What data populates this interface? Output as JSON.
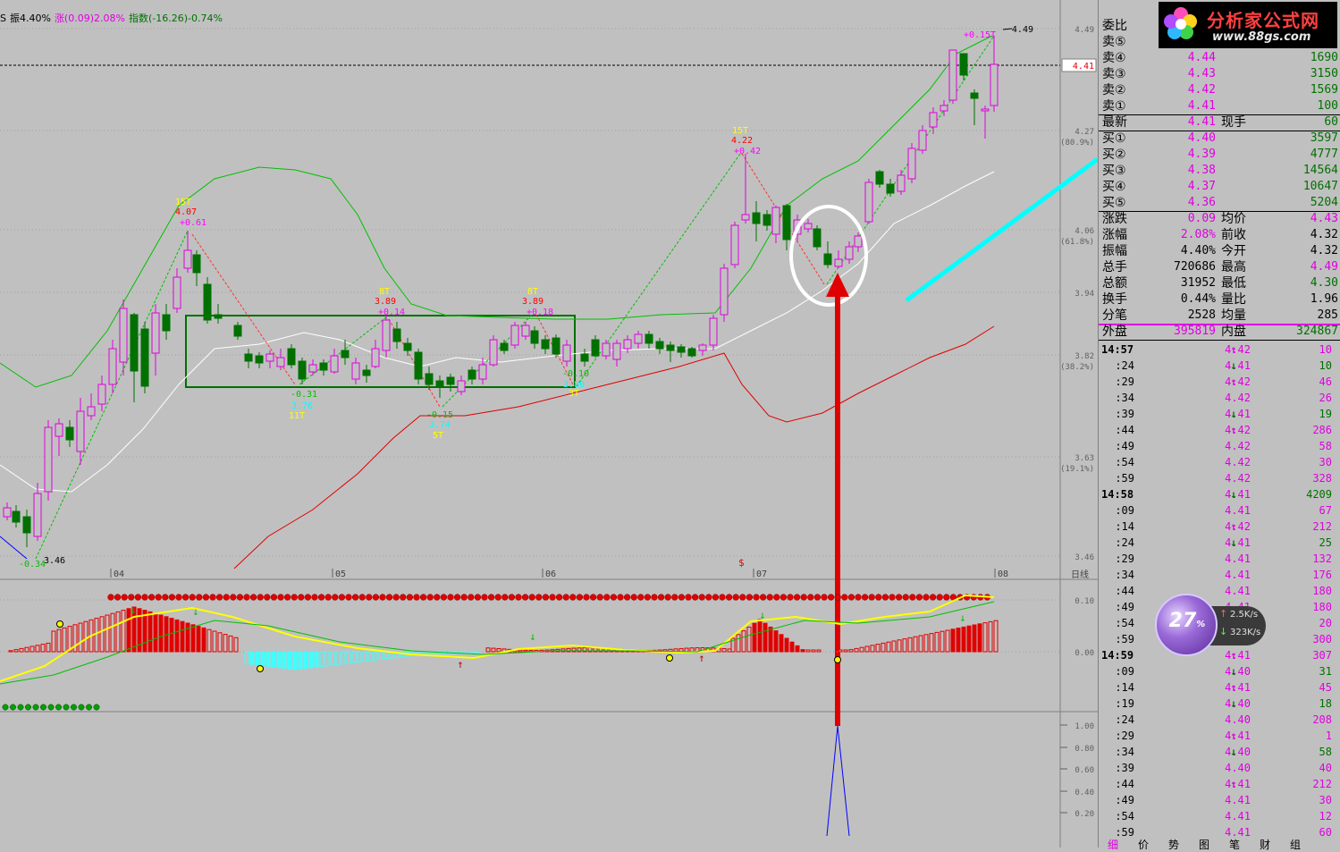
{
  "info_bar": {
    "prefix": "S",
    "amplitude": "振4.40%",
    "change": "涨(0.09)2.08%",
    "index": "指数(-16.26)-0.74%"
  },
  "price_axis": [
    {
      "label": "4.49"
    },
    {
      "label": "4.27",
      "pct": "(80.9%)"
    },
    {
      "label": "4.06",
      "pct": "(61.8%)"
    },
    {
      "label": "3.94"
    },
    {
      "label": "3.82",
      "pct": "(38.2%)"
    },
    {
      "label": "3.63",
      "pct": "(19.1%)"
    },
    {
      "label": "3.46"
    }
  ],
  "current_price_tag": "4.41",
  "high_price_tag": "4.49",
  "months": [
    "04",
    "05",
    "06",
    "07",
    "08"
  ],
  "period_label": "日线",
  "chart_annotations": [
    {
      "text": "15T",
      "color": "#ffff00"
    },
    {
      "text": "4.07",
      "color": "#ff0000"
    },
    {
      "text": "+0.61",
      "color": "#ff00ff"
    },
    {
      "text": "8T",
      "color": "#ffff00"
    },
    {
      "text": "3.89",
      "color": "#ff0000"
    },
    {
      "text": "+0.14",
      "color": "#ff00ff"
    },
    {
      "text": "8T",
      "color": "#ffff00"
    },
    {
      "text": "3.89",
      "color": "#ff0000"
    },
    {
      "text": "+0.18",
      "color": "#ff00ff"
    },
    {
      "text": "15T",
      "color": "#ffff00"
    },
    {
      "text": "4.22",
      "color": "#ff0000"
    },
    {
      "text": "+0.42",
      "color": "#ff00ff"
    },
    {
      "text": "-0.31",
      "color": "#00c000"
    },
    {
      "text": "3.76",
      "color": "#00ffff"
    },
    {
      "text": "11T",
      "color": "#ffff00"
    },
    {
      "text": "-0.15",
      "color": "#00c000"
    },
    {
      "text": "3.74",
      "color": "#00ffff"
    },
    {
      "text": "5T",
      "color": "#ffff00"
    },
    {
      "text": "-0.10",
      "color": "#00c000"
    },
    {
      "text": "3.80",
      "color": "#00ffff"
    },
    {
      "text": "3T",
      "color": "#ffff00"
    },
    {
      "text": "-0.34",
      "color": "#00c000"
    },
    {
      "text": "3.46",
      "color": "#000000"
    },
    {
      "text": "+0.15T",
      "color": "#ff00ff"
    }
  ],
  "macd_axis": [
    "0.10",
    "0.00"
  ],
  "bottom_axis": [
    "1.00",
    "0.80",
    "0.60",
    "0.40",
    "0.20"
  ],
  "quote": {
    "weibi_label": "委比",
    "asks": [
      {
        "label": "卖⑤",
        "price": "",
        "vol": ""
      },
      {
        "label": "卖④",
        "price": "4.44",
        "vol": "1690"
      },
      {
        "label": "卖③",
        "price": "4.43",
        "vol": "3150"
      },
      {
        "label": "卖②",
        "price": "4.42",
        "vol": "1569"
      },
      {
        "label": "卖①",
        "price": "4.41",
        "vol": "100"
      }
    ],
    "latest": {
      "label": "最新",
      "price": "4.41",
      "label2": "现手",
      "vol": "60"
    },
    "bids": [
      {
        "label": "买①",
        "price": "4.40",
        "vol": "3597"
      },
      {
        "label": "买②",
        "price": "4.39",
        "vol": "4777"
      },
      {
        "label": "买③",
        "price": "4.38",
        "vol": "14564"
      },
      {
        "label": "买④",
        "price": "4.37",
        "vol": "10647"
      },
      {
        "label": "买⑤",
        "price": "4.36",
        "vol": "5204"
      }
    ],
    "stats": [
      {
        "l1": "涨跌",
        "v1": "0.09",
        "c1": "pink",
        "l2": "均价",
        "v2": "4.43",
        "c2": "pink"
      },
      {
        "l1": "涨幅",
        "v1": "2.08%",
        "c1": "pink",
        "l2": "前收",
        "v2": "4.32",
        "c2": "black"
      },
      {
        "l1": "振幅",
        "v1": "4.40%",
        "c1": "black",
        "l2": "今开",
        "v2": "4.32",
        "c2": "black"
      },
      {
        "l1": "总手",
        "v1": "720686",
        "c1": "black",
        "l2": "最高",
        "v2": "4.49",
        "c2": "pink"
      },
      {
        "l1": "总额",
        "v1": "31952",
        "c1": "black",
        "l2": "最低",
        "v2": "4.30",
        "c2": "green"
      },
      {
        "l1": "换手",
        "v1": "0.44%",
        "c1": "black",
        "l2": "量比",
        "v2": "1.96",
        "c2": "black"
      },
      {
        "l1": "分笔",
        "v1": "2528",
        "c1": "black",
        "l2": "均量",
        "v2": "285",
        "c2": "black"
      }
    ],
    "outer_label": "外盘",
    "outer_vol": "395819",
    "inner_label": "内盘",
    "inner_vol": "324867"
  },
  "ticks": [
    {
      "time": "14:57",
      "bold": true,
      "price": "4.42",
      "dir": "up",
      "vol": "10"
    },
    {
      "time": ":24",
      "price": "4.41",
      "dir": "dn",
      "vol": "10"
    },
    {
      "time": ":29",
      "price": "4.42",
      "dir": "up",
      "vol": "46"
    },
    {
      "time": ":34",
      "price": "4.42",
      "dir": "",
      "vol": "26"
    },
    {
      "time": ":39",
      "price": "4.41",
      "dir": "dn",
      "vol": "19"
    },
    {
      "time": ":44",
      "price": "4.42",
      "dir": "up",
      "vol": "286"
    },
    {
      "time": ":49",
      "price": "4.42",
      "dir": "",
      "vol": "58"
    },
    {
      "time": ":54",
      "price": "4.42",
      "dir": "",
      "vol": "30"
    },
    {
      "time": ":59",
      "price": "4.42",
      "dir": "",
      "vol": "328"
    },
    {
      "time": "14:58",
      "bold": true,
      "price": "4.41",
      "dir": "dn",
      "vol": "4209"
    },
    {
      "time": ":09",
      "price": "4.41",
      "dir": "",
      "vol": "67"
    },
    {
      "time": ":14",
      "price": "4.42",
      "dir": "up",
      "vol": "212"
    },
    {
      "time": ":24",
      "price": "4.41",
      "dir": "dn",
      "vol": "25"
    },
    {
      "time": ":29",
      "price": "4.41",
      "dir": "",
      "vol": "132"
    },
    {
      "time": ":34",
      "price": "4.41",
      "dir": "",
      "vol": "176"
    },
    {
      "time": ":44",
      "price": "4.41",
      "dir": "",
      "vol": "180"
    },
    {
      "time": ":49",
      "price": "4.41",
      "dir": "",
      "vol": "180"
    },
    {
      "time": ":54",
      "price": "4.41",
      "dir": "",
      "vol": "20"
    },
    {
      "time": ":59",
      "price": "4.41",
      "dir": "",
      "vol": "300"
    },
    {
      "time": "14:59",
      "bold": true,
      "price": "4.41",
      "dir": "up",
      "vol": "307"
    },
    {
      "time": ":09",
      "price": "4.40",
      "dir": "dn",
      "vol": "31"
    },
    {
      "time": ":14",
      "price": "4.41",
      "dir": "up",
      "vol": "45"
    },
    {
      "time": ":19",
      "price": "4.40",
      "dir": "dn",
      "vol": "18"
    },
    {
      "time": ":24",
      "price": "4.40",
      "dir": "",
      "vol": "208"
    },
    {
      "time": ":29",
      "price": "4.41",
      "dir": "up",
      "vol": "1"
    },
    {
      "time": ":34",
      "price": "4.40",
      "dir": "dn",
      "vol": "58"
    },
    {
      "time": ":39",
      "price": "4.40",
      "dir": "",
      "vol": "40"
    },
    {
      "time": ":44",
      "price": "4.41",
      "dir": "up",
      "vol": "212"
    },
    {
      "time": ":49",
      "price": "4.41",
      "dir": "",
      "vol": "30"
    },
    {
      "time": ":54",
      "price": "4.41",
      "dir": "",
      "vol": "12"
    },
    {
      "time": ":59",
      "price": "4.41",
      "dir": "",
      "vol": "60"
    }
  ],
  "logo": {
    "brand": "分析家公式网",
    "url": "www.88gs.com"
  },
  "speed": {
    "percent": "27",
    "percent_sign": "%",
    "up_rate": "2.5K/s",
    "down_rate": "323K/s"
  },
  "bottom_tabs": [
    "细",
    "价",
    "势",
    "图",
    "笔",
    "财",
    "组"
  ],
  "colors": {
    "up": "#e000e0",
    "down": "#007000",
    "ma_green": "#00c000",
    "ma_white": "#ffffff",
    "ma_red": "#e00000",
    "macd_yellow": "#ffff00",
    "macd_cyan": "#40ffff"
  }
}
